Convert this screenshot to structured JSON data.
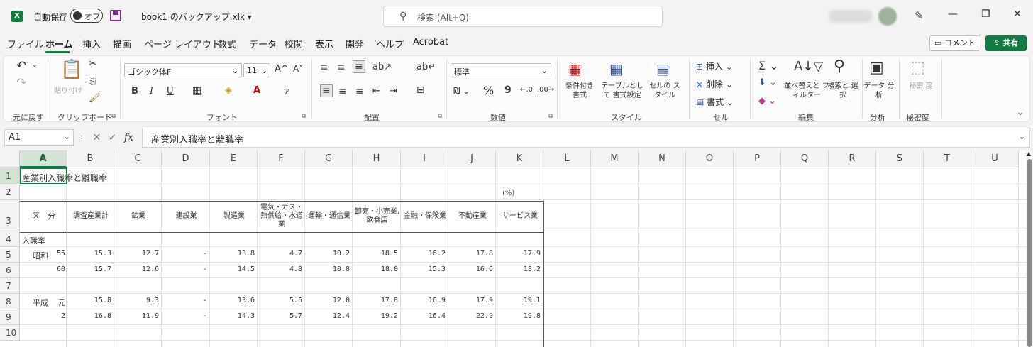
{
  "titlebar": {
    "app_icon": "X",
    "autosave_label": "自動保存",
    "autosave_state": "オフ",
    "filename": "book1 のバックアップ.xlk",
    "filename_caret": "▾",
    "search_placeholder": "検索 (Alt+Q)",
    "minimize": "—",
    "restore": "❐",
    "close": "✕",
    "pen": "✎"
  },
  "menu": {
    "items": [
      "ファイル",
      "ホーム",
      "挿入",
      "描画",
      "ページ レイアウト",
      "数式",
      "データ",
      "校閲",
      "表示",
      "開発",
      "ヘルプ",
      "Acrobat"
    ],
    "comment": "コメント",
    "share": "共有"
  },
  "ribbon": {
    "undo_group": "元に戻す",
    "clipboard_group": "クリップボード",
    "paste": "貼り付け",
    "font_group": "フォント",
    "font_name": "ゴシック体F",
    "font_size": "11",
    "bold": "B",
    "italic": "I",
    "underline": "U",
    "align_group": "配置",
    "number_group": "数値",
    "number_format": "標準",
    "percent": "%",
    "comma": "9",
    "style_group": "スタイル",
    "cond_format": "条件付き 書式",
    "table_format": "テーブルとして 書式設定",
    "cell_style": "セルの スタイル",
    "cells_group": "セル",
    "insert": "挿入",
    "delete": "削除",
    "format": "書式",
    "edit_group": "編集",
    "sort_filter": "並べ替えと フィルター",
    "find_select": "検索と 選択",
    "analysis_group": "分析",
    "data_analysis": "データ 分析",
    "sensitivity_group": "秘密度",
    "sensitivity": "秘密 度"
  },
  "formula": {
    "namebox": "A1",
    "cancel": "✕",
    "enter": "✓",
    "fx": "fx",
    "content": "産業別入職率と離職率"
  },
  "sheet": {
    "columns": [
      "A",
      "B",
      "C",
      "D",
      "E",
      "F",
      "G",
      "H",
      "I",
      "J",
      "K",
      "L",
      "M",
      "N",
      "O",
      "P",
      "Q",
      "R",
      "S",
      "T",
      "U"
    ],
    "rows": [
      "1",
      "2",
      "3",
      "4",
      "5",
      "6",
      "7",
      "8",
      "9",
      "10"
    ],
    "title": "産業別入職率と離職率",
    "unit": "(%)",
    "headers": [
      "区　分",
      "調査産業計",
      "鉱業",
      "建設業",
      "製造業",
      "電気・ガス・熱供給・水道業",
      "運輸・通信業",
      "卸売・小売業,飲食店",
      "金融・保険業",
      "不動産業",
      "サービス業"
    ],
    "row4_label": "入職率",
    "data_rows": [
      {
        "era": "昭和",
        "year": "55",
        "values": [
          "15.3",
          "12.7",
          "-",
          "13.8",
          "4.7",
          "10.2",
          "18.5",
          "16.2",
          "17.8",
          "17.9"
        ]
      },
      {
        "era": "",
        "year": "60",
        "values": [
          "15.7",
          "12.6",
          "-",
          "14.5",
          "4.8",
          "10.8",
          "18.0",
          "15.3",
          "16.6",
          "18.2"
        ]
      },
      {
        "era": "平成",
        "year": "元",
        "values": [
          "15.8",
          "9.3",
          "-",
          "13.6",
          "5.5",
          "12.0",
          "17.8",
          "16.9",
          "17.9",
          "19.1"
        ]
      },
      {
        "era": "",
        "year": "2",
        "values": [
          "16.8",
          "11.9",
          "-",
          "14.3",
          "5.7",
          "12.4",
          "19.2",
          "16.4",
          "22.9",
          "19.8"
        ]
      }
    ]
  },
  "colors": {
    "accent": "#107c41"
  }
}
